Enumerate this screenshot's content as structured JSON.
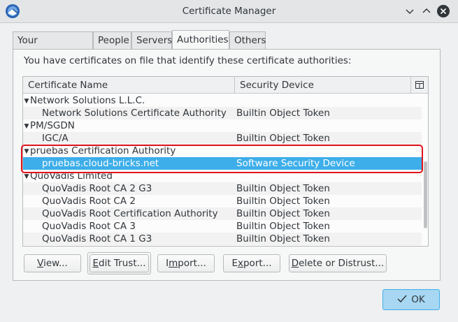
{
  "window": {
    "title": "Certificate Manager"
  },
  "tabs": [
    {
      "label": "Your Certificates",
      "active": false
    },
    {
      "label": "People",
      "active": false
    },
    {
      "label": "Servers",
      "active": false
    },
    {
      "label": "Authorities",
      "active": true
    },
    {
      "label": "Others",
      "active": false
    }
  ],
  "intro_text": "You have certificates on file that identify these certificate authorities:",
  "table": {
    "columns": [
      "Certificate Name",
      "Security Device"
    ],
    "rows": [
      {
        "type": "group",
        "name": "Network Solutions L.L.C.",
        "device": ""
      },
      {
        "type": "cert",
        "name": "Network Solutions Certificate Authority",
        "device": "Builtin Object Token"
      },
      {
        "type": "group",
        "name": "PM/SGDN",
        "device": ""
      },
      {
        "type": "cert",
        "name": "IGC/A",
        "device": "Builtin Object Token"
      },
      {
        "type": "group",
        "name": "pruebas Certification Authority",
        "device": ""
      },
      {
        "type": "cert",
        "name": "pruebas.cloud-bricks.net",
        "device": "Software Security Device",
        "selected": true
      },
      {
        "type": "group",
        "name": "QuoVadis Limited",
        "device": ""
      },
      {
        "type": "cert",
        "name": "QuoVadis Root CA 2 G3",
        "device": "Builtin Object Token"
      },
      {
        "type": "cert",
        "name": "QuoVadis Root CA 2",
        "device": "Builtin Object Token"
      },
      {
        "type": "cert",
        "name": "QuoVadis Root Certification Authority",
        "device": "Builtin Object Token"
      },
      {
        "type": "cert",
        "name": "QuoVadis Root CA 3",
        "device": "Builtin Object Token"
      },
      {
        "type": "cert",
        "name": "QuoVadis Root CA 1 G3",
        "device": "Builtin Object Token"
      }
    ]
  },
  "buttons": {
    "view": {
      "pre": "",
      "key": "V",
      "post": "iew..."
    },
    "edit_trust": {
      "pre": "",
      "key": "E",
      "post": "dit Trust..."
    },
    "import": {
      "pre": "I",
      "key": "m",
      "post": "port..."
    },
    "export": {
      "pre": "E",
      "key": "x",
      "post": "port..."
    },
    "delete": {
      "pre": "",
      "key": "D",
      "post": "elete or Distrust..."
    },
    "ok": "OK"
  },
  "colors": {
    "selection": "#3daee9",
    "highlight_annotation": "#e0141b",
    "ok_button": "#a7d7f2"
  }
}
